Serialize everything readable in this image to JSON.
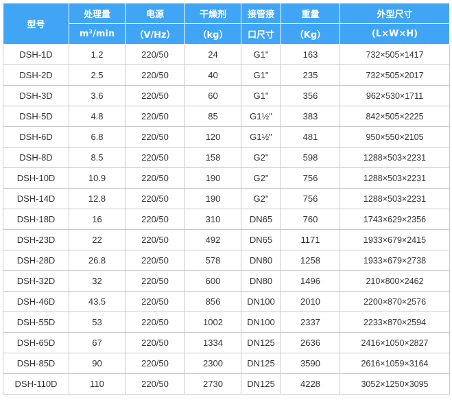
{
  "table": {
    "headers": {
      "model": "型号",
      "capacity": "处理量",
      "capacity_unit": "m³/min",
      "power": "电源",
      "power_unit": "（V/Hz）",
      "desiccant": "干燥剂",
      "desiccant_unit": "（kg）",
      "pipe": "接管接",
      "pipe_2": "口尺寸",
      "weight": "重量",
      "weight_unit": "（Kg）",
      "dimensions": "外型尺寸",
      "dimensions_unit": "(L×W×H)"
    },
    "rows": [
      [
        "DSH-1D",
        "1.2",
        "220/50",
        "24",
        "G1\"",
        "163",
        "732×505×1417"
      ],
      [
        "DSH-2D",
        "2.5",
        "220/50",
        "40",
        "G1\"",
        "235",
        "732×505×2017"
      ],
      [
        "DSH-3D",
        "3.6",
        "220/50",
        "60",
        "G1\"",
        "356",
        "962×530×1711"
      ],
      [
        "DSH-5D",
        "4.8",
        "220/50",
        "85",
        "G1½\"",
        "383",
        "842×505×2225"
      ],
      [
        "DSH-6D",
        "6.8",
        "220/50",
        "120",
        "G1½\"",
        "481",
        "950×550×2105"
      ],
      [
        "DSH-8D",
        "8.5",
        "220/50",
        "158",
        "G2\"",
        "598",
        "1288×503×2231"
      ],
      [
        "DSH-10D",
        "10.9",
        "220/50",
        "190",
        "G2\"",
        "756",
        "1288×503×2231"
      ],
      [
        "DSH-14D",
        "12.8",
        "220/50",
        "190",
        "G2\"",
        "756",
        "1288×503×2231"
      ],
      [
        "DSH-18D",
        "16",
        "220/50",
        "310",
        "DN65",
        "760",
        "1743×629×2356"
      ],
      [
        "DSH-23D",
        "22",
        "220/50",
        "492",
        "DN65",
        "1171",
        "1933×679×2415"
      ],
      [
        "DSH-28D",
        "26.8",
        "220/50",
        "578",
        "DN80",
        "1258",
        "1933×679×2738"
      ],
      [
        "DSH-32D",
        "32",
        "220/50",
        "600",
        "DN80",
        "1496",
        "210×800×2462"
      ],
      [
        "DSH-46D",
        "43.5",
        "220/50",
        "856",
        "DN100",
        "2010",
        "2200×870×2576"
      ],
      [
        "DSH-55D",
        "53",
        "220/50",
        "1002",
        "DN100",
        "2337",
        "2233×870×2594"
      ],
      [
        "DSH-65D",
        "67",
        "220/50",
        "1334",
        "DN125",
        "2636",
        "2416×1050×2827"
      ],
      [
        "DSH-85D",
        "90",
        "220/50",
        "2300",
        "DN125",
        "3590",
        "2616×1059×3164"
      ],
      [
        "DSH-110D",
        "110",
        "220/50",
        "2730",
        "DN125",
        "4228",
        "3052×1250×3095"
      ]
    ]
  }
}
